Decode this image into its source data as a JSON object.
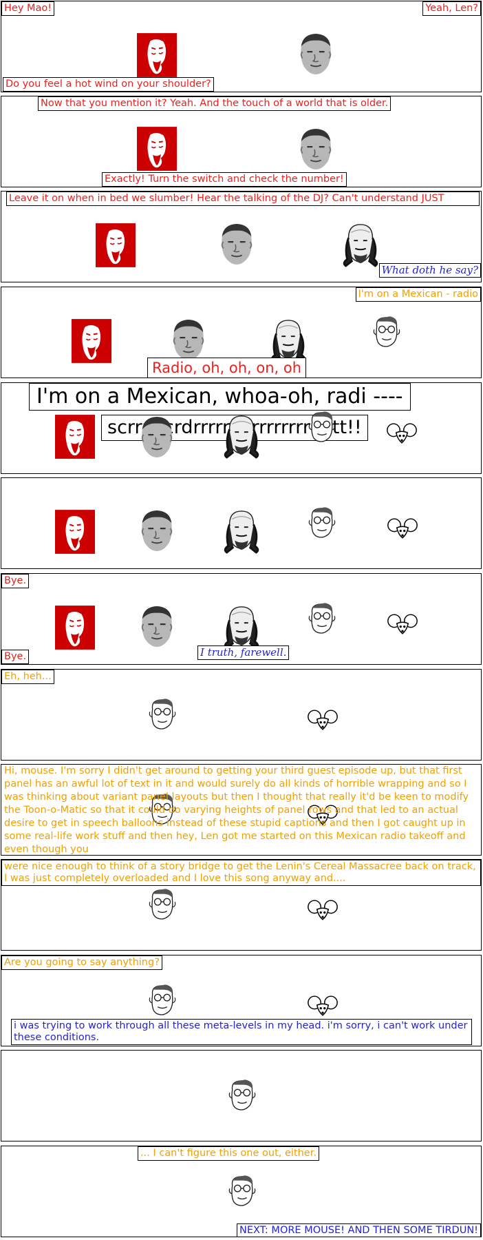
{
  "colors": {
    "lenin_red": "#cc0000",
    "mao_gray": "#8a8a8a",
    "caption_red": "#e8231f",
    "caption_orange": "#f0a000",
    "caption_blue": "#2323d0"
  },
  "icons": [
    "lenin-face-icon",
    "mao-face-icon",
    "shakespeare-face-icon",
    "cartoonist-face-icon",
    "mouse-face-icon"
  ],
  "panels": [
    {
      "captions": [
        "Hey Mao!",
        "Yeah, Len?",
        "Do you feel a hot wind on your shoulder?"
      ]
    },
    {
      "captions": [
        "Now that you mention it?  Yeah.  And the touch of a world that is older.",
        "Exactly!  Turn the switch and check the number!"
      ]
    },
    {
      "captions": [
        "Leave it on when in bed we slumber! Hear the talking of the DJ?  Can't understand JUST",
        "What doth he say?"
      ]
    },
    {
      "captions": [
        "I'm on a Mexican - radio",
        "Radio, oh, oh, on, oh"
      ]
    },
    {
      "captions": [
        "I'm on a Mexican, whoa-oh, radi ----",
        "scrrrrrcrdrrrrrrrrrrrrrrrrrrttt!!"
      ]
    },
    {
      "captions": []
    },
    {
      "captions": [
        "Bye.",
        "Bye.",
        "I truth, farewell."
      ]
    },
    {
      "captions": [
        "Eh, heh..."
      ]
    },
    {
      "captions": [
        "Hi, mouse.  I'm sorry I didn't get around to getting your third guest episode up, but that first panel has an awful lot of text in it and would surely do all kinds of horrible wrapping and so I was thinking about variant panel layouts but then I thought that really it'd be keen to modify the Toon-o-Matic so that it could do varying heights of panel rows and that led to an actual desire to get in speech balloons instead of these stupid captions and then I got caught up in some real-life work stuff and then hey, Len got me started on this Mexican radio takeoff and even though you"
      ]
    },
    {
      "captions": [
        "were nice enough to think of a story bridge to get the Lenin's Cereal Massacree back on track, I was just completely overloaded and I love this song anyway and...."
      ]
    },
    {
      "captions": [
        "Are you going to say anything?",
        "i was trying to work through all these meta-levels in my head.  i'm sorry, i can't work under these conditions."
      ]
    },
    {
      "captions": []
    },
    {
      "captions": [
        "... I can't figure this one out, either.",
        "NEXT: MORE MOUSE!  AND THEN SOME TIRDUN!"
      ]
    }
  ]
}
